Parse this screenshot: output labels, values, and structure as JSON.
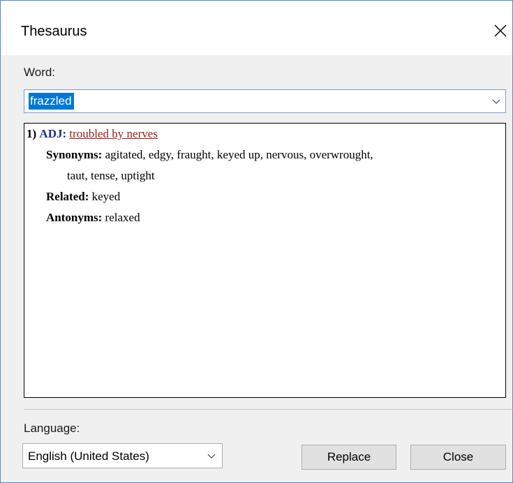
{
  "window": {
    "title": "Thesaurus",
    "close_icon": "close-icon"
  },
  "word": {
    "label": "Word:",
    "value": "frazzled"
  },
  "results": {
    "entry_number": "1)",
    "part_of_speech": "ADJ:",
    "definition": "troubled by nerves",
    "synonyms_label": "Synonyms:",
    "synonyms_line1": "agitated, edgy, fraught, keyed up, nervous, overwrought,",
    "synonyms_line2": "taut, tense, uptight",
    "related_label": "Related:",
    "related": "keyed",
    "antonyms_label": "Antonyms:",
    "antonyms": "relaxed"
  },
  "language": {
    "label": "Language:",
    "selected": "English (United States)"
  },
  "buttons": {
    "replace": "Replace",
    "close": "Close"
  },
  "colors": {
    "part_of_speech": "#1e2a8c",
    "definition": "#9b1c1c",
    "selection": "#0078d7"
  }
}
